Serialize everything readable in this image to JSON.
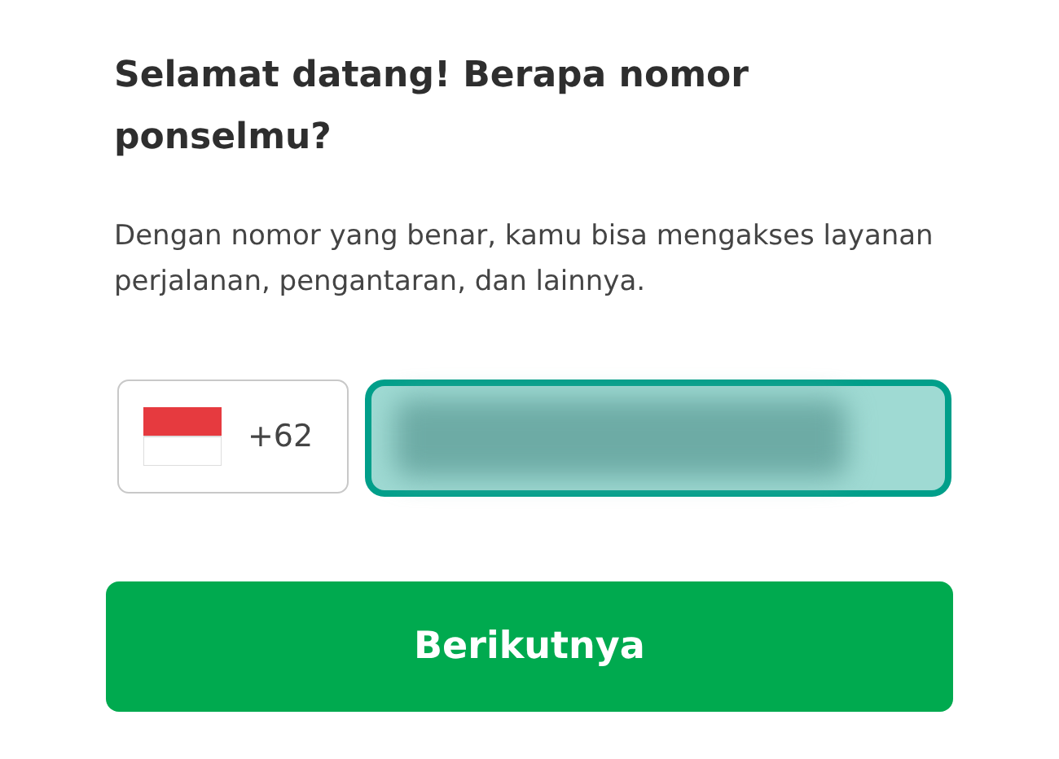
{
  "title": "Selamat datang! Berapa nomor ponselmu?",
  "description": "Dengan nomor yang benar, kamu bisa mengakses layanan perjalanan, pengantaran, dan lainnya.",
  "country_code": {
    "code": "+62"
  },
  "phone_field": {
    "focused": true
  },
  "button": {
    "label": "Berikutnya"
  }
}
